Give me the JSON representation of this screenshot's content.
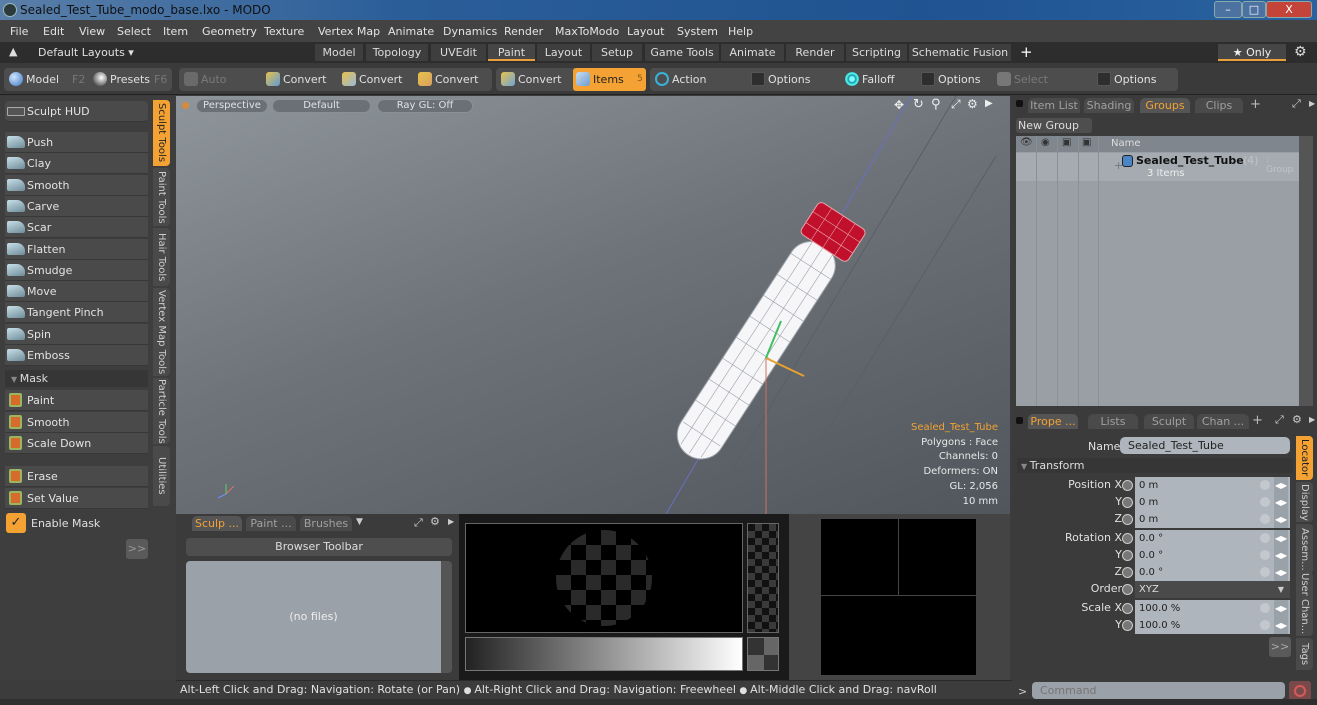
{
  "window": {
    "title": "Sealed_Test_Tube_modo_base.lxo - MODO",
    "controls": {
      "minimize": "–",
      "restore": "□",
      "close": "X"
    }
  },
  "menubar": [
    "File",
    "Edit",
    "View",
    "Select",
    "Item",
    "Geometry",
    "Texture",
    "Vertex Map",
    "Animate",
    "Dynamics",
    "Render",
    "MaxToModo",
    "Layout",
    "System",
    "Help"
  ],
  "layoutbar": {
    "layouts_label": "Default Layouts ▾",
    "tabs": [
      "Model",
      "Topology",
      "UVEdit",
      "Paint",
      "Layout",
      "Setup",
      "Game Tools",
      "Animate",
      "Render",
      "Scripting",
      "Schematic Fusion"
    ],
    "active_tab": "Paint",
    "add": "+",
    "only_label": "★ Only"
  },
  "toolbar": {
    "model": "Model",
    "model_key": "F2",
    "presets": "Presets",
    "presets_key": "F6",
    "auto_select": "Auto Select",
    "convert": [
      "Convert",
      "Convert",
      "Convert",
      "Convert"
    ],
    "items": "Items",
    "items_key": "5",
    "action_center": "Action Center",
    "options1": "Options",
    "falloff": "Falloff",
    "options2": "Options",
    "select_through": "Select Through",
    "options3": "Options"
  },
  "sculpt_panel": {
    "hud": "Sculpt HUD",
    "tools": [
      "Push",
      "Clay",
      "Smooth",
      "Carve",
      "Scar",
      "Flatten",
      "Smudge",
      "Move",
      "Tangent Pinch",
      "Spin",
      "Emboss"
    ],
    "mask_header": "Mask",
    "mask_tools": [
      "Paint",
      "Smooth",
      "Scale Down"
    ],
    "mask_tools2": [
      "Erase",
      "Set Value"
    ],
    "enable_mask": "Enable Mask",
    "enable_mask_checked": true,
    "more": ">>",
    "vtabs": [
      "Sculpt Tools",
      "Paint Tools",
      "Hair Tools",
      "Vertex Map Tools",
      "Particle Tools",
      "Utilities"
    ],
    "active_vtab": "Sculpt Tools"
  },
  "viewport": {
    "view": "Perspective",
    "shading": "Default",
    "raygl": "Ray GL: Off",
    "info": {
      "item": "Sealed_Test_Tube",
      "polygons": "Polygons : Face",
      "channels": "Channels: 0",
      "deformers": "Deformers: ON",
      "gl": "GL: 2,056",
      "scale": "10 mm"
    },
    "colors": {
      "cap": "#c0102c",
      "info_accent": "#f4a233"
    }
  },
  "browser": {
    "tabs": [
      "Sculp ...",
      "Paint ...",
      "Brushes"
    ],
    "toolbar": "Browser Toolbar",
    "empty": "(no files)"
  },
  "groups_panel": {
    "tabs": [
      "Item List",
      "Shading",
      "Groups",
      "Clips"
    ],
    "active_tab": "Groups",
    "new_group": "New Group",
    "col_name": "Name",
    "group": {
      "name": "Sealed_Test_Tube",
      "count": "(4)",
      "type": ": Group",
      "sub": "3 Items"
    }
  },
  "properties": {
    "tabs": [
      "Prope ...",
      "Lists",
      "Sculpt",
      "Chan ..."
    ],
    "active_tab": "Prope ...",
    "name_label": "Name",
    "name_value": "Sealed_Test_Tube",
    "transform": "Transform",
    "rows": [
      {
        "label": "Position X",
        "value": "0 m"
      },
      {
        "label": "Y",
        "value": "0 m"
      },
      {
        "label": "Z",
        "value": "0 m"
      },
      {
        "label": "Rotation X",
        "value": "0.0 °"
      },
      {
        "label": "Y",
        "value": "0.0 °"
      },
      {
        "label": "Z",
        "value": "0.0 °"
      },
      {
        "label": "Order",
        "value": "XYZ"
      },
      {
        "label": "Scale X",
        "value": "100.0 %"
      },
      {
        "label": "Y",
        "value": "100.0 %"
      }
    ],
    "more": ">>",
    "vtabs": [
      "Locator",
      "Display",
      "Assem...",
      "User Chan...",
      "Tags"
    ],
    "active_vtab": "Locator"
  },
  "statusbar": {
    "hint1": "Alt-Left Click and Drag: Navigation: Rotate (or Pan)",
    "hint2": "Alt-Right Click and Drag: Navigation: Freewheel",
    "hint3": "Alt-Middle Click and Drag: navRoll"
  },
  "command": {
    "placeholder": "Command",
    "prompt": ">"
  }
}
